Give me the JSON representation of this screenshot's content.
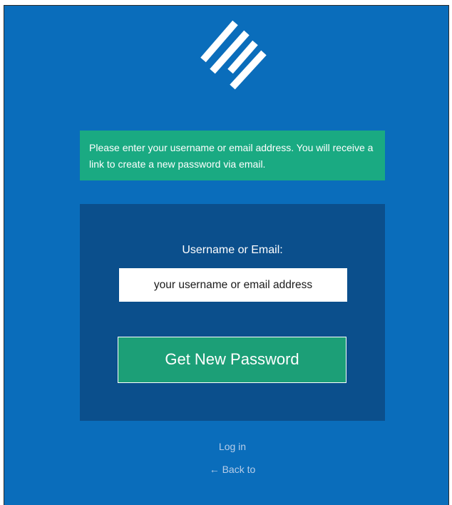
{
  "logo": {
    "icon": "stripes-logo-icon"
  },
  "notice": {
    "text": "Please enter your username or email address. You will receive a link to create a new password via email."
  },
  "form": {
    "label": "Username or Email:",
    "input_value": "",
    "input_placeholder": "your username or email address",
    "submit_label": "Get New Password"
  },
  "links": {
    "login": "Log in",
    "back": "← Back to"
  },
  "colors": {
    "background": "#0a6dbb",
    "panel": "#0b4f8c",
    "notice": "#1aaa82",
    "button": "#1c9f77"
  }
}
